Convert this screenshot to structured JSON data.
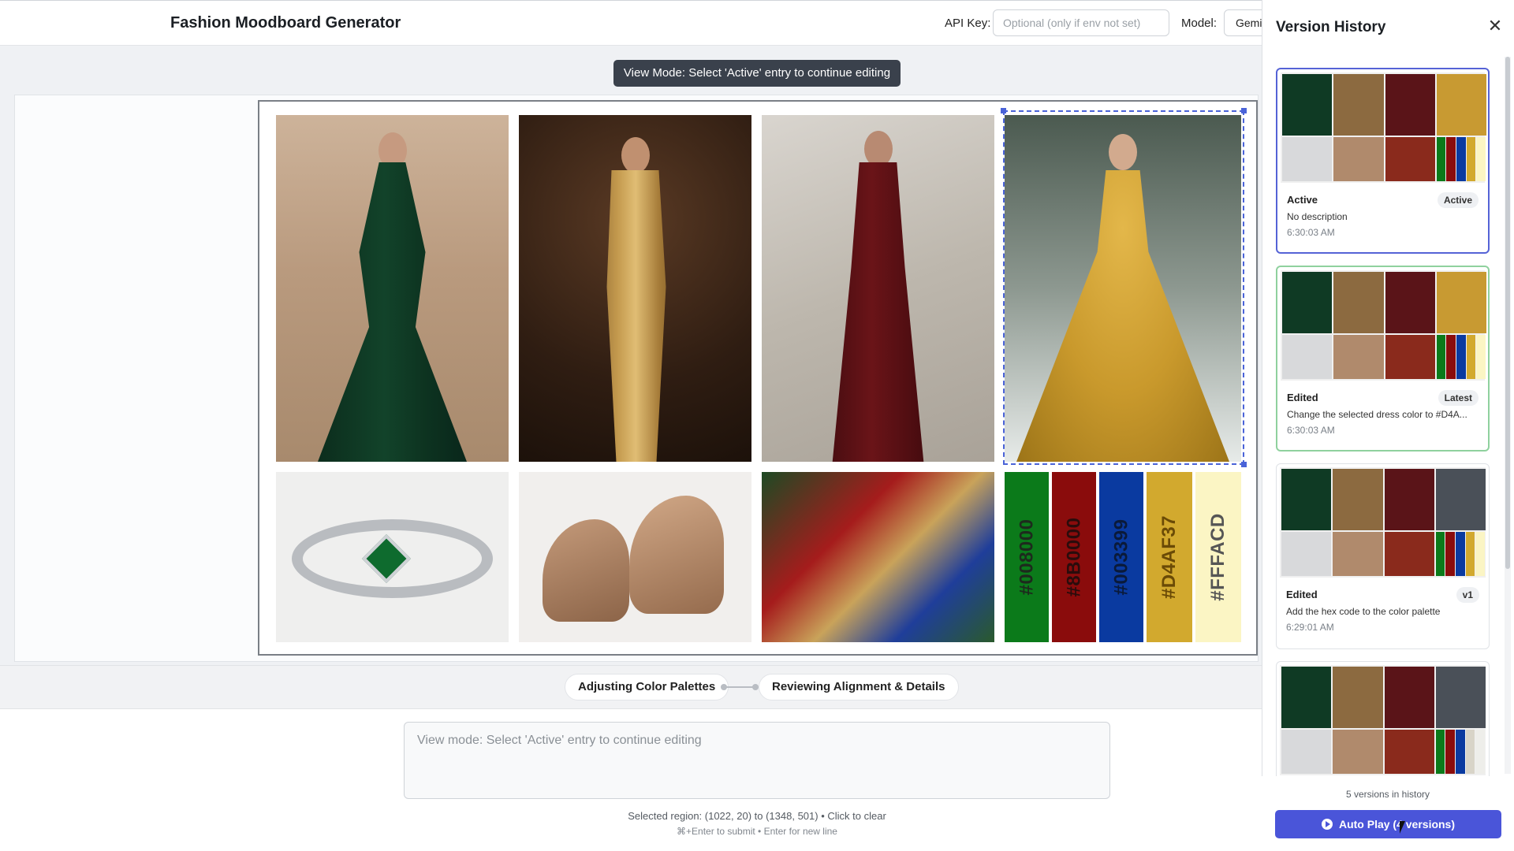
{
  "header": {
    "title": "Fashion Moodboard Generator",
    "api_key_label": "API Key:",
    "api_key_placeholder": "Optional (only if env not set)",
    "model_label": "Model:",
    "model_value": "Gemi"
  },
  "toast": "View Mode: Select 'Active' entry to continue editing",
  "palette": [
    {
      "hex_label": "#008000",
      "color": "#0b7a1a",
      "text": "#1d2a1d"
    },
    {
      "hex_label": "#8B0000",
      "color": "#8a0c0c",
      "text": "#2a0c0c"
    },
    {
      "hex_label": "#003399",
      "color": "#0a3aa0",
      "text": "#0a1a3a"
    },
    {
      "hex_label": "#D4AF37",
      "color": "#d2a92e",
      "text": "#6a4a06"
    },
    {
      "hex_label": "#FFFACD",
      "color": "#fbf5c4",
      "text": "#555"
    }
  ],
  "steps": [
    "Adjusting Color Palettes",
    "Reviewing Alignment & Details"
  ],
  "prompt": {
    "placeholder": "View mode: Select 'Active' entry to continue editing",
    "hint_selection": "Selected region: (1022, 20) to (1348, 501) • Click to clear",
    "hint_keys": "⌘+Enter to submit • Enter for new line"
  },
  "history": {
    "title": "Version History",
    "count_text": "5 versions in history",
    "autoplay_label": "Auto Play (4 versions)",
    "versions": [
      {
        "kind": "Active",
        "badge": "Active",
        "description": "No description",
        "time": "6:30:03 AM"
      },
      {
        "kind": "Edited",
        "badge": "Latest",
        "description": "Change the selected dress color to #D4A...",
        "time": "6:30:03 AM"
      },
      {
        "kind": "Edited",
        "badge": "v1",
        "description": "Add the hex code to the color palette",
        "time": "6:29:01 AM"
      },
      {
        "kind": "",
        "badge": "",
        "description": "",
        "time": ""
      }
    ]
  },
  "colors": {
    "accent": "#4a55d9",
    "selection": "#4a63d8",
    "active_border": "#5563d6",
    "latest_border": "#8fd19e"
  }
}
